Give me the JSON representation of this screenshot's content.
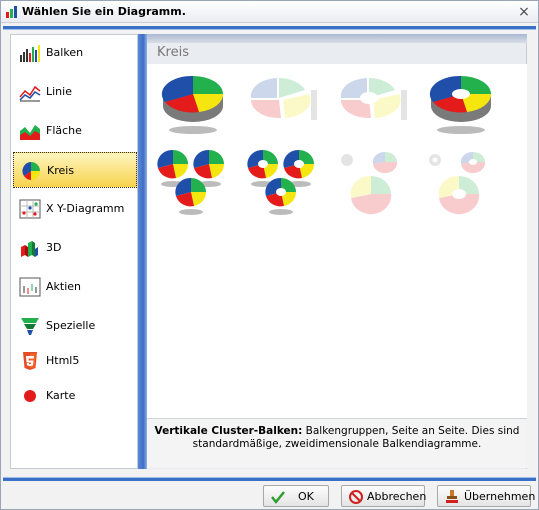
{
  "dialog": {
    "title": "Wählen Sie ein Diagramm.",
    "close_label": "×"
  },
  "sidebar": {
    "items": [
      {
        "label": "Balken",
        "icon": "bar-chart-icon"
      },
      {
        "label": "Linie",
        "icon": "line-chart-icon"
      },
      {
        "label": "Fläche",
        "icon": "area-chart-icon"
      },
      {
        "label": "Kreis",
        "icon": "pie-chart-icon",
        "selected": true
      },
      {
        "label": "X Y-Diagramm",
        "icon": "xy-chart-icon"
      },
      {
        "label": "3D",
        "icon": "3d-chart-icon"
      },
      {
        "label": "Aktien",
        "icon": "stock-chart-icon"
      },
      {
        "label": "Spezielle",
        "icon": "funnel-icon"
      },
      {
        "label": "Html5",
        "icon": "html5-icon"
      },
      {
        "label": "Karte",
        "icon": "map-dot-icon"
      }
    ]
  },
  "main": {
    "title": "Kreis",
    "description": {
      "bold": "Vertikale Cluster-Balken:",
      "text": " Balkengruppen, Seite an Seite. Dies sind standardmäßige, zweidimensionale Balkendiagramme."
    }
  },
  "buttons": {
    "ok": "OK",
    "cancel": "Abbrechen",
    "apply": "Übernehmen"
  },
  "colors": {
    "accent": "#3a6fc7",
    "pie_blue": "#1f4fa8",
    "pie_green": "#22b14c",
    "pie_yellow": "#f5e60f",
    "pie_red": "#e31b1b"
  }
}
